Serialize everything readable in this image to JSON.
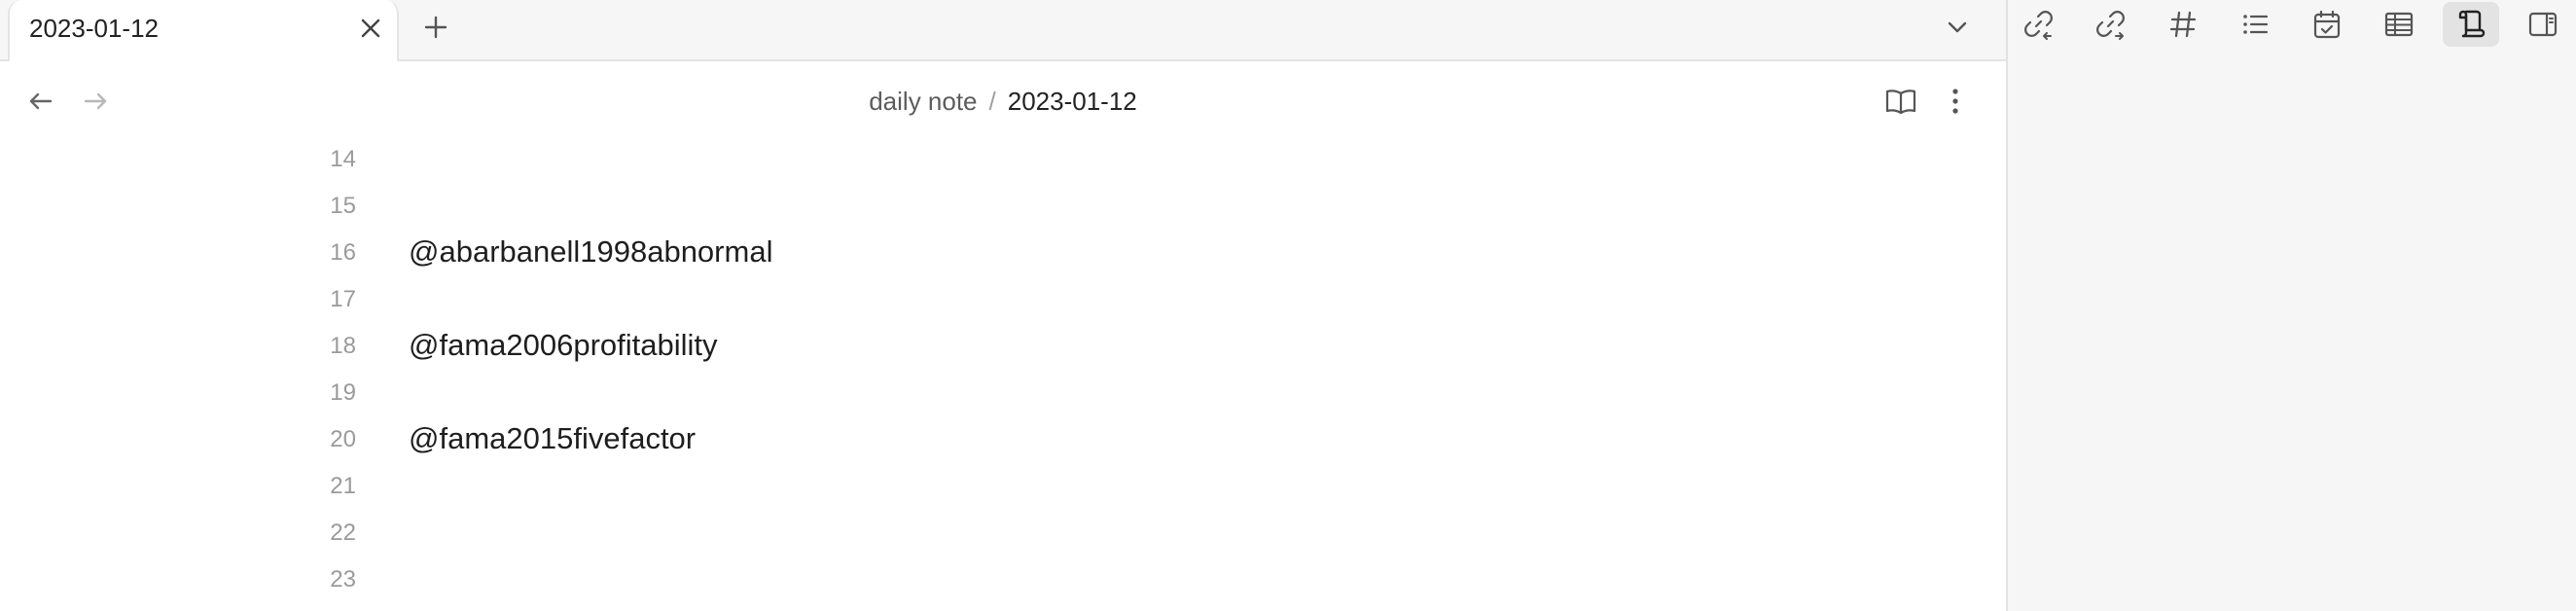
{
  "tabs": [
    {
      "title": "2023-01-12"
    }
  ],
  "breadcrumb": {
    "parent": "daily note",
    "separator": "/",
    "current": "2023-01-12"
  },
  "editor": {
    "lines": [
      {
        "number": "14",
        "text": ""
      },
      {
        "number": "15",
        "text": ""
      },
      {
        "number": "16",
        "text": "@abarbanell1998abnormal"
      },
      {
        "number": "17",
        "text": ""
      },
      {
        "number": "18",
        "text": "@fama2006profitability"
      },
      {
        "number": "19",
        "text": ""
      },
      {
        "number": "20",
        "text": "@fama2015fivefactor"
      },
      {
        "number": "21",
        "text": ""
      },
      {
        "number": "22",
        "text": ""
      },
      {
        "number": "23",
        "text": ""
      }
    ]
  },
  "right_toolbar": {
    "active": "outline-icon",
    "buttons": [
      "backlinks-icon",
      "outgoing-links-icon",
      "tags-icon",
      "list-icon",
      "calendar-icon",
      "table-icon",
      "outline-icon",
      "sidebar-toggle-icon"
    ]
  },
  "colors": {
    "background": "#ffffff",
    "tabbar_bg": "#f6f6f6",
    "sidebar_bg": "#f6f6f6",
    "line_number": "#9a9a9a",
    "text": "#1e1e1e"
  }
}
